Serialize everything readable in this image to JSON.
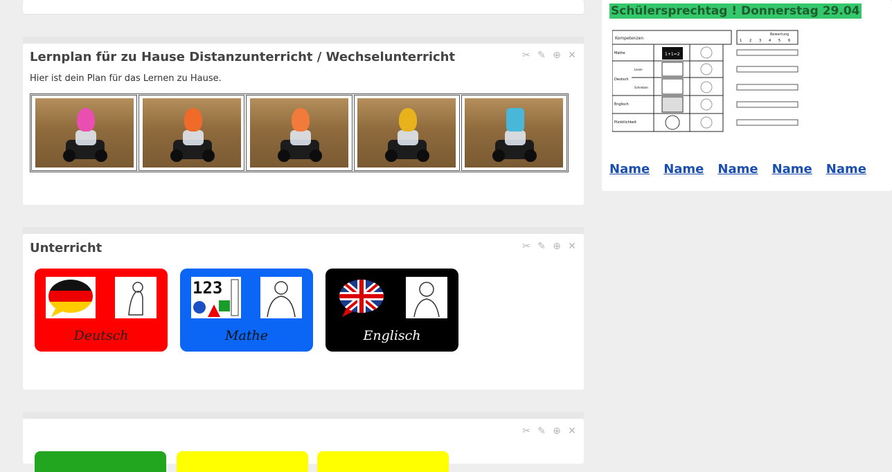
{
  "main": {
    "cards": [
      {
        "title": "Lernplan für zu Hause Distanzunterricht / Wechselunterricht",
        "description": "Hier ist dein Plan für das Lernen zu Hause.",
        "images": [
          {
            "figure_color": "#e84fb0"
          },
          {
            "figure_color": "#f06a2a"
          },
          {
            "figure_color": "#f27a3a"
          },
          {
            "figure_color": "#e8b21c"
          },
          {
            "figure_color": "#49b8d8"
          }
        ]
      },
      {
        "title": "Unterricht",
        "subjects": [
          {
            "label": "Deutsch",
            "color": "#ff0000",
            "text_color": "#222222"
          },
          {
            "label": "Mathe",
            "color": "#0b66f5",
            "text_color": "#111111"
          },
          {
            "label": "Englisch",
            "color": "#000000",
            "text_color": "#ffffff"
          }
        ]
      },
      {
        "title": "",
        "subject_colors": [
          "#22a51f",
          "#ffff00",
          "#ffff00"
        ]
      }
    ],
    "tool_icons": [
      "scissors-icon",
      "pencil-icon",
      "copy-icon",
      "close-icon"
    ]
  },
  "sidebar": {
    "highlight": "Schülersprechtag ! Donnerstag 29.04",
    "worksheet": {
      "header": "Kompetenzen",
      "rows": [
        "Mathe",
        "Deutsch",
        "Englisch",
        "Pünktlichkeit"
      ],
      "sub_rows": [
        "Lesen",
        "Schreiben"
      ],
      "math_tile": "1+1=2",
      "rating_title": "Bewertung",
      "rating_scale": [
        "1",
        "2",
        "3",
        "4",
        "5",
        "6"
      ]
    },
    "name_links": [
      "Name",
      "Name",
      "Name",
      "Name",
      "Name"
    ]
  }
}
